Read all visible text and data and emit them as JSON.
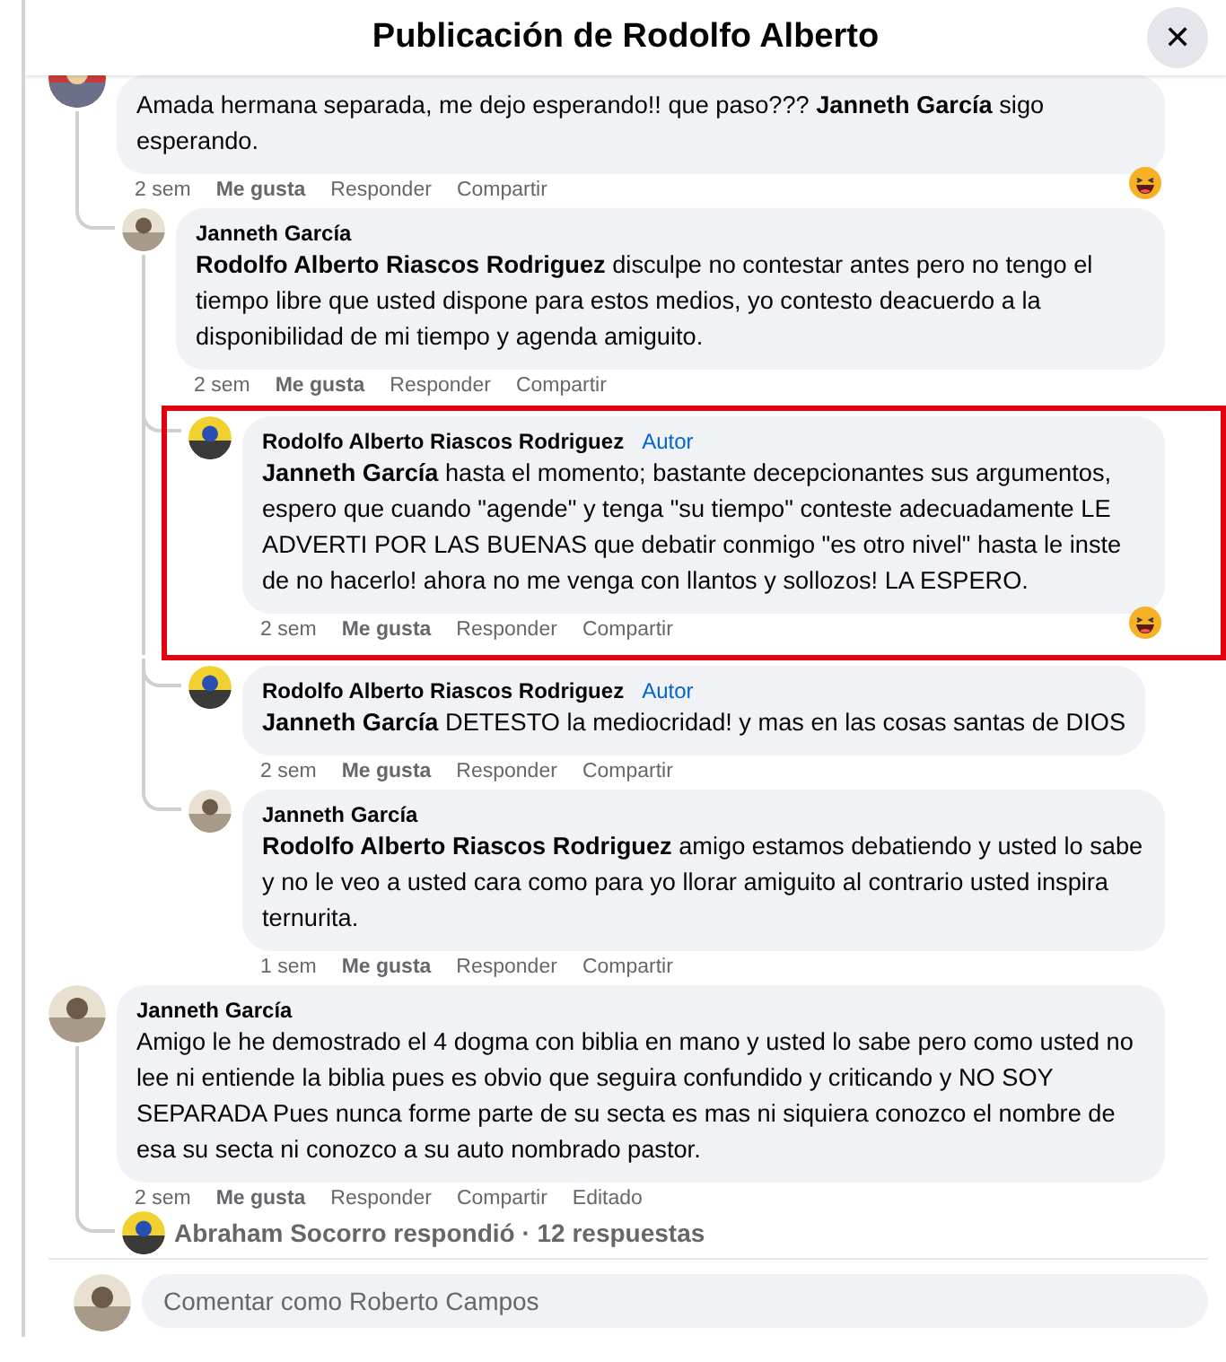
{
  "dialog": {
    "title": "Publicación de Rodolfo Alberto",
    "close": "✕"
  },
  "comments": [
    {
      "text": "Amada hermana separada, me dejo esperando!! que paso??? **Janneth García** sigo esperando.",
      "time": "2 sem",
      "like": "Me gusta",
      "reply": "Responder",
      "share": "Compartir",
      "reaction": {
        "kind": "haha"
      },
      "children": [
        {
          "author": "Janneth García",
          "text": "**Rodolfo Alberto Riascos Rodriguez** disculpe no contestar antes pero no tengo el tiempo libre que usted dispone para estos medios, yo contesto deacuerdo a la disponibilidad de mi tiempo y agenda amiguito.",
          "time": "2 sem",
          "like": "Me gusta",
          "reply": "Responder",
          "share": "Compartir",
          "children": [
            {
              "author": "Rodolfo Alberto Riascos Rodriguez",
              "badge": "Autor",
              "highlighted": true,
              "text": "**Janneth García** hasta el momento; bastante decepcionantes sus argumentos, espero que cuando \"agende\" y tenga \"su tiempo\" conteste adecuadamente LE ADVERTI POR LAS BUENAS que debatir conmigo \"es otro nivel\" hasta le inste de no hacerlo! ahora no me venga con llantos y sollozos! LA ESPERO.",
              "time": "2 sem",
              "like": "Me gusta",
              "reply": "Responder",
              "share": "Compartir",
              "reaction": {
                "kind": "haha"
              }
            },
            {
              "author": "Rodolfo Alberto Riascos Rodriguez",
              "badge": "Autor",
              "highlighted": false,
              "text": "**Janneth García** DETESTO la mediocridad! y mas en las cosas santas de DIOS",
              "time": "2 sem",
              "like": "Me gusta",
              "reply": "Responder",
              "share": "Compartir"
            },
            {
              "author": "Janneth García",
              "highlighted": false,
              "text": "**Rodolfo Alberto Riascos Rodriguez** amigo estamos debatiendo y usted lo sabe y no le veo a usted cara como para yo llorar amiguito al contrario usted inspira ternurita.",
              "time": "1 sem",
              "like": "Me gusta",
              "reply": "Responder",
              "share": "Compartir"
            }
          ]
        }
      ]
    },
    {
      "author": "Janneth García",
      "text": "Amigo le he demostrado el 4 dogma con biblia en mano y usted lo sabe pero como usted no lee ni entiende la biblia pues es obvio que seguira confundido y criticando y NO SOY SEPARADA Pues nunca forme parte de su secta es mas ni siquiera conozco el nombre de esa su secta ni conozco a su auto nombrado pastor.",
      "time": "2 sem",
      "like": "Me gusta",
      "reply": "Responder",
      "share": "Compartir",
      "edited": "Editado",
      "replies_summary": "Abraham Socorro respondió · 12 respuestas"
    }
  ],
  "composer": {
    "placeholder": "Comentar como Roberto Campos"
  }
}
